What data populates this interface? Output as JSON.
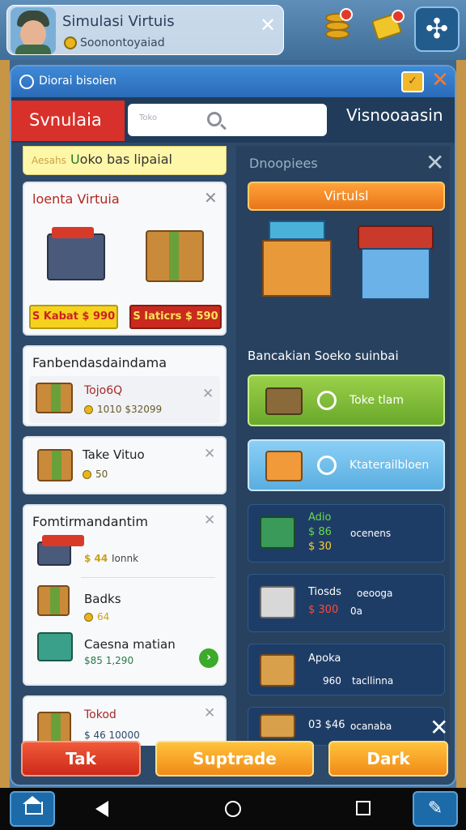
{
  "profile": {
    "name": "Simulasi Virtuis",
    "subtitle": "Soonontoyaiad"
  },
  "panel": {
    "title": "Diorai bisoien"
  },
  "tabs": {
    "active": "Svnulaia",
    "right": "Visnooaasin"
  },
  "search": {
    "placeholder": "Toko"
  },
  "left": {
    "ribbon_prefix": "Aesahs",
    "ribbon_hl": "U",
    "ribbon_text": "oko bas lipaial",
    "card1": {
      "title": "loenta Virtuia",
      "price1": "S Kabat $ 990",
      "price2": "S Iaticrs $ 590"
    },
    "card2": {
      "title": "Fanbendasdaindama",
      "item_title": "Tojo6Q",
      "item_price": "1010  $32099"
    },
    "card3": {
      "title": "Take Vituo",
      "price": "50"
    },
    "card4": {
      "title": "Fomtirmandantim",
      "rows": [
        {
          "title": "",
          "price": "$ 44",
          "extra": "Ionnk"
        },
        {
          "title": "Badks",
          "price": "64",
          "extra": ""
        },
        {
          "title": "Caesna matian",
          "price": "$85 1,290",
          "extra": ""
        }
      ]
    },
    "card5": {
      "title": "Tokod",
      "price": "$ 46 10000"
    }
  },
  "right": {
    "header": "Dnoopiees",
    "orange": "Virtulsl",
    "section": "Bancakian Soeko suinbai",
    "green_btn": "Toke tlam",
    "blue_btn": "Ktaterailbloen",
    "rows": [
      {
        "a": "Adio",
        "b": "$ 86",
        "c": "$ 30",
        "d": "ocenens"
      },
      {
        "a": "Tiosds",
        "b": "$ 300",
        "c": "oeooga",
        "d": "0a"
      },
      {
        "a": "Apoka",
        "b": "960",
        "c": "tacllinna"
      },
      {
        "a": "03 $46",
        "b": "ocanaba"
      }
    ]
  },
  "bottom": {
    "btn1": "Tak",
    "btn2": "Suptrade",
    "btn3": "Dark"
  },
  "colors": {
    "red": "#d8302a",
    "orange": "#f08a1a",
    "green": "#6aa82a",
    "blue": "#2a6bb8"
  }
}
